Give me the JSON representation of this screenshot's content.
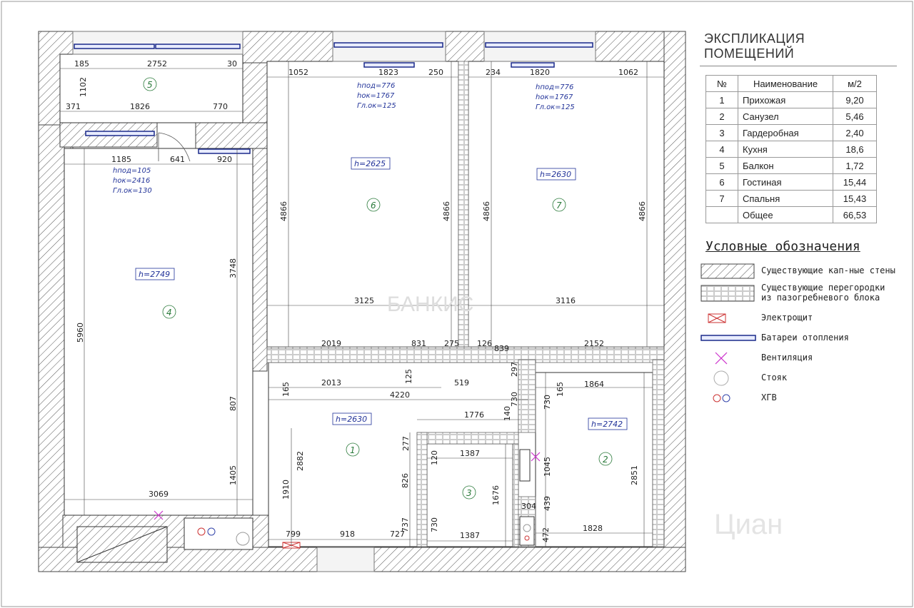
{
  "explication": {
    "title": "ЭКСПЛИКАЦИЯ ПОМЕЩЕНИЙ",
    "headers": [
      "№",
      "Наименование",
      "м/2"
    ],
    "rows": [
      {
        "no": "1",
        "name": "Прихожая",
        "area": "9,20"
      },
      {
        "no": "2",
        "name": "Санузел",
        "area": "5,46"
      },
      {
        "no": "3",
        "name": "Гардеробная",
        "area": "2,40"
      },
      {
        "no": "4",
        "name": "Кухня",
        "area": "18,6"
      },
      {
        "no": "5",
        "name": "Балкон",
        "area": "1,72"
      },
      {
        "no": "6",
        "name": "Гостиная",
        "area": "15,44"
      },
      {
        "no": "7",
        "name": "Спальня",
        "area": "15,43"
      },
      {
        "no": "",
        "name": "Общее",
        "area": "66,53"
      }
    ]
  },
  "symbols": {
    "title": "Условные обозначения",
    "items": [
      {
        "label": "Существующие кап-ные стены"
      },
      {
        "label": "Существующие перегородки\nиз пазогребневого блока"
      },
      {
        "label": "Электрощит"
      },
      {
        "label": "Батареи отопления"
      },
      {
        "label": "Вентиляция"
      },
      {
        "label": "Стояк"
      },
      {
        "label": "ХГВ"
      }
    ]
  },
  "rooms": {
    "r1": {
      "no": "1",
      "h": "h=2630"
    },
    "r2": {
      "no": "2",
      "h": "h=2742"
    },
    "r3": {
      "no": "3"
    },
    "r4": {
      "no": "4",
      "h": "h=2749"
    },
    "r5": {
      "no": "5"
    },
    "r6": {
      "no": "6",
      "h": "h=2625"
    },
    "r7": {
      "no": "7",
      "h": "h=2630"
    }
  },
  "window_notes": {
    "w_kitchen": [
      "hпод=105",
      "hок=2416",
      "Гл.ок=130"
    ],
    "w_living": [
      "hпод=776",
      "hок=1767",
      "Гл.ок=125"
    ],
    "w_bedroom": [
      "hпод=776",
      "hок=1767",
      "Гл.ок=125"
    ]
  },
  "dimensions": {
    "d185": "185",
    "d2752": "2752",
    "d30": "30",
    "d1102": "1102",
    "d371": "371",
    "d1826": "1826",
    "d770": "770",
    "d1185": "1185",
    "d641": "641",
    "d920": "920",
    "d5960": "5960",
    "d3748": "3748",
    "d807": "807",
    "d1405": "1405",
    "d3069": "3069",
    "d1052": "1052",
    "d1823": "1823",
    "d250": "250",
    "d4866a": "4866",
    "d4866b": "4866",
    "d3125": "3125",
    "d234": "234",
    "d1820": "1820",
    "d1062": "1062",
    "d4866c": "4866",
    "d4866d": "4866",
    "d3116": "3116",
    "d2019": "2019",
    "d831": "831",
    "d275": "275",
    "d126": "126",
    "d839": "839",
    "d2152": "2152",
    "d2013": "2013",
    "d125": "125",
    "d519": "519",
    "d297": "297",
    "d165a": "165",
    "d4220": "4220",
    "d730a": "730",
    "d1776": "1776",
    "d140": "140",
    "d165b": "165",
    "d1864": "1864",
    "d730b": "730",
    "d277": "277",
    "d120": "120",
    "d1387a": "1387",
    "d1045": "1045",
    "d2851": "2851",
    "d2882": "2882",
    "d1910": "1910",
    "d826": "826",
    "d1676": "1676",
    "d304": "304",
    "d439": "439",
    "d737": "737",
    "d730c": "730",
    "d1387b": "1387",
    "d472": "472",
    "d1828": "1828",
    "d799": "799",
    "d918": "918",
    "d727": "727"
  },
  "watermark": "БАНКИС",
  "watermark2": "Циан",
  "colors": {
    "wall": "#555555",
    "radiator": "#1a2a8a",
    "vent": "#cc33cc",
    "panel": "#cc3333"
  }
}
